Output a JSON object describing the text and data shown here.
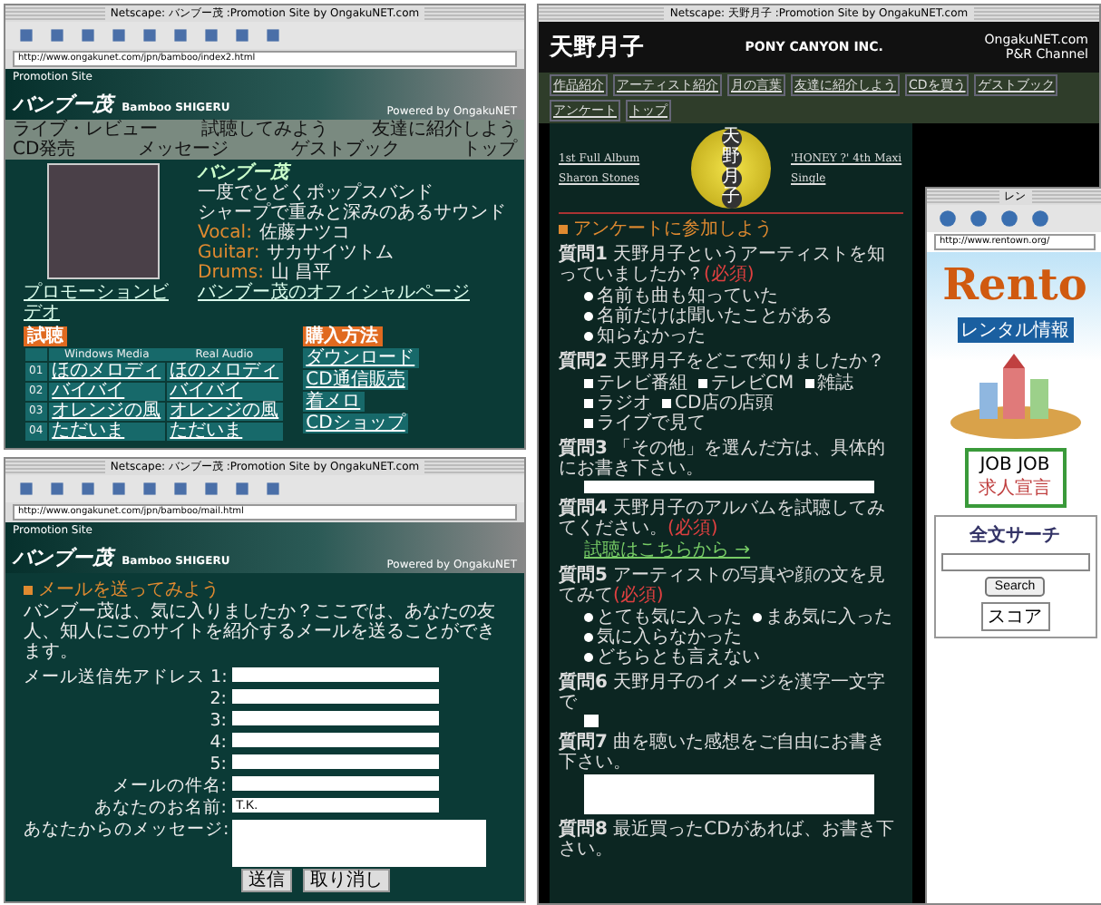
{
  "bamboo_window": {
    "title": "Netscape: バンブー茂 :Promotion Site by OngakuNET.com",
    "url": "http://www.ongakunet.com/jpn/bamboo/index2.html",
    "site_label": "Promotion Site",
    "logo": "バンブー茂",
    "logo_en": "Bamboo SHIGERU",
    "credit": "Powered by OngakuNET",
    "nav": [
      "ライブ・レビュー",
      "試聴してみよう",
      "友達に紹介しよう",
      "CD発売",
      "メッセージ",
      "ゲストブック",
      "トップ"
    ],
    "band_logo": "バンブー茂",
    "description": [
      "一度でとどくポップスバンド",
      "シャープで重みと深みのあるサウンド"
    ],
    "members": [
      {
        "role": "Vocal:",
        "name": "佐藤ナツコ"
      },
      {
        "role": "Guitar:",
        "name": "サカサイツトム"
      },
      {
        "role": "Drums:",
        "name": "山 昌平"
      }
    ],
    "official_link": "バンブー茂のオフィシャルページ",
    "video_link": "プロモーションビデオ",
    "trial": {
      "heading": "試聴",
      "columns": [
        "Windows Media",
        "Real Audio"
      ],
      "rows": [
        {
          "num": "01",
          "cells": [
            "ほのメロディ",
            "ほのメロディ"
          ]
        },
        {
          "num": "02",
          "cells": [
            "バイバイ",
            "バイバイ"
          ]
        },
        {
          "num": "03",
          "cells": [
            "オレンジの風",
            "オレンジの風"
          ]
        },
        {
          "num": "04",
          "cells": [
            "ただいま",
            "ただいま"
          ]
        }
      ]
    },
    "purchase": {
      "heading": "購入方法",
      "items": [
        "ダウンロード",
        "CD通信販売",
        "着メロ",
        "CDショップ"
      ]
    }
  },
  "mail_window": {
    "title": "Netscape: バンブー茂 :Promotion Site by OngakuNET.com",
    "url": "http://www.ongakunet.com/jpn/bamboo/mail.html",
    "site_label": "Promotion Site",
    "logo": "バンブー茂",
    "logo_en": "Bamboo SHIGERU",
    "credit": "Powered by OngakuNET",
    "heading": "メールを送ってみよう",
    "intro": "バンブー茂は、気に入りましたか？ここでは、あなたの友人、知人にこのサイトを紹介するメールを送ることができます。",
    "fields": [
      {
        "label": "メール送信先アドレス 1:"
      },
      {
        "label": "2:"
      },
      {
        "label": "3:"
      },
      {
        "label": "4:"
      },
      {
        "label": "5:"
      },
      {
        "label": "メールの件名:"
      },
      {
        "label": "あなたのお名前:",
        "value": "T.K."
      }
    ],
    "message_label": "あなたからのメッセージ:",
    "buttons": [
      "送信",
      "取り消し"
    ]
  },
  "amano_window": {
    "title": "Netscape: 天野月子 :Promotion Site by OngakuNET.com",
    "logo": "天野月子",
    "label": "PONY CANYON INC.",
    "network": "OngakuNET.com",
    "channel": "P&R Channel",
    "nav": [
      "作品紹介",
      "アーティスト紹介",
      "月の言葉",
      "友達に紹介しよう",
      "CDを買う",
      "ゲストブック",
      "アンケート",
      "トップ"
    ],
    "album": "1st Full Album  Sharon Stones",
    "single": "'HONEY ?'  4th Maxi Single",
    "circle_chars": [
      "天",
      "野",
      "月",
      "子"
    ],
    "heading": "アンケートに参加しよう",
    "questions": [
      {
        "kind": "radio",
        "num": "質問1",
        "text": "天野月子というアーティストを知っていましたか？",
        "required": "(必須)",
        "options": [
          {
            "label": "名前も曲も知っていた",
            "checked": false
          },
          {
            "label": "名前だけは聞いたことがある",
            "checked": false
          },
          {
            "label": "知らなかった",
            "checked": false
          }
        ]
      },
      {
        "kind": "check",
        "num": "質問2",
        "text": "天野月子をどこで知りましたか？",
        "options": [
          {
            "label": "テレビ番組",
            "checked": false
          },
          {
            "label": "テレビCM",
            "checked": false
          },
          {
            "label": "雑誌",
            "checked": false
          },
          {
            "label": "ラジオ",
            "checked": false
          },
          {
            "label": "CD店の店頭",
            "checked": false
          },
          {
            "label": "ライブで見て",
            "checked": false
          }
        ]
      },
      {
        "kind": "input",
        "num": "質問3",
        "text": "「その他」を選んだ方は、具体的にお書き下さい。"
      },
      {
        "kind": "link",
        "num": "質問4",
        "text": "天野月子のアルバムを試聴してみてください。",
        "required": "(必須)",
        "link": "試聴はこちらから →"
      },
      {
        "kind": "radio",
        "num": "質問5",
        "text": "アーティストの写真や顔の文を見てみて",
        "required": "(必須)",
        "options": [
          {
            "label": "とても気に入った",
            "checked": false
          },
          {
            "label": "まあ気に入った",
            "checked": false
          },
          {
            "label": "気に入らなかった",
            "checked": false
          },
          {
            "label": "どちらとも言えない",
            "checked": false
          }
        ]
      },
      {
        "kind": "small_input",
        "num": "質問6",
        "text": "天野月子のイメージを漢字一文字で"
      },
      {
        "kind": "textarea",
        "num": "質問7",
        "text": "曲を聴いた感想をご自由にお書き下さい。"
      },
      {
        "kind": "plain",
        "num": "質問8",
        "text": "最近買ったCDがあれば、お書き下さい。"
      }
    ]
  },
  "rentown_window": {
    "title": "レン",
    "url": "http://www.rentown.org/",
    "logo": "Rento",
    "tagline": "レンタル情報",
    "job": "JOB JOB",
    "job_sub": "求人宣言",
    "search_heading": "全文サーチ",
    "search_button": "Search",
    "sort": "スコア"
  }
}
